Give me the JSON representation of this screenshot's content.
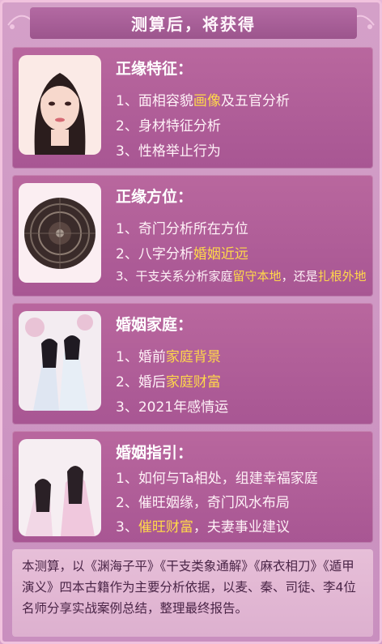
{
  "header": {
    "title": "测算后，将获得"
  },
  "cards": [
    {
      "title": "正缘特征：",
      "lines": [
        {
          "prefix": "1、面相容貌",
          "hl1": "画像",
          "mid": "及五官分析",
          "hl2": "",
          "suffix": ""
        },
        {
          "prefix": "2、身材特征分析",
          "hl1": "",
          "mid": "",
          "hl2": "",
          "suffix": ""
        },
        {
          "prefix": "3、性格举止行为",
          "hl1": "",
          "mid": "",
          "hl2": "",
          "suffix": ""
        }
      ],
      "image_icon": "woman-portrait-icon"
    },
    {
      "title": "正缘方位：",
      "lines": [
        {
          "prefix": "1、奇门分析所在方位",
          "hl1": "",
          "mid": "",
          "hl2": "",
          "suffix": ""
        },
        {
          "prefix": "2、八字分析",
          "hl1": "婚姻近远",
          "mid": "",
          "hl2": "",
          "suffix": ""
        },
        {
          "prefix": "3、干支关系分析家庭",
          "hl1": "留守本地",
          "mid": "，还是",
          "hl2": "扎根外地",
          "suffix": ""
        }
      ],
      "image_icon": "compass-icon"
    },
    {
      "title": "婚姻家庭：",
      "lines": [
        {
          "prefix": "1、婚前",
          "hl1": "家庭背景",
          "mid": "",
          "hl2": "",
          "suffix": ""
        },
        {
          "prefix": "2、婚后",
          "hl1": "家庭财富",
          "mid": "",
          "hl2": "",
          "suffix": ""
        },
        {
          "prefix": "3、2021年感情运",
          "hl1": "",
          "mid": "",
          "hl2": "",
          "suffix": ""
        }
      ],
      "image_icon": "couple-illustration-icon"
    },
    {
      "title": "婚姻指引：",
      "lines": [
        {
          "prefix": "1、如何与Ta相处，组建幸福家庭",
          "hl1": "",
          "mid": "",
          "hl2": "",
          "suffix": ""
        },
        {
          "prefix": "2、催旺姻缘，奇门风水布局",
          "hl1": "",
          "mid": "",
          "hl2": "",
          "suffix": ""
        },
        {
          "prefix": "3、",
          "hl1": "催旺财富",
          "mid": "，夫妻事业建议",
          "hl2": "",
          "suffix": ""
        }
      ],
      "image_icon": "women-illustration-icon"
    }
  ],
  "footer": {
    "text": "本测算，以《渊海子平》《干支类象通解》《麻衣相刀》《遁甲演义》四本古籍作为主要分析依据，以麦、秦、司徒、李4位名师分享实战案例总结，整理最终报告。"
  },
  "colors": {
    "highlight": "#ffd84a",
    "card_bg": "#b05c97",
    "page_bg": "#d4a0c8"
  }
}
